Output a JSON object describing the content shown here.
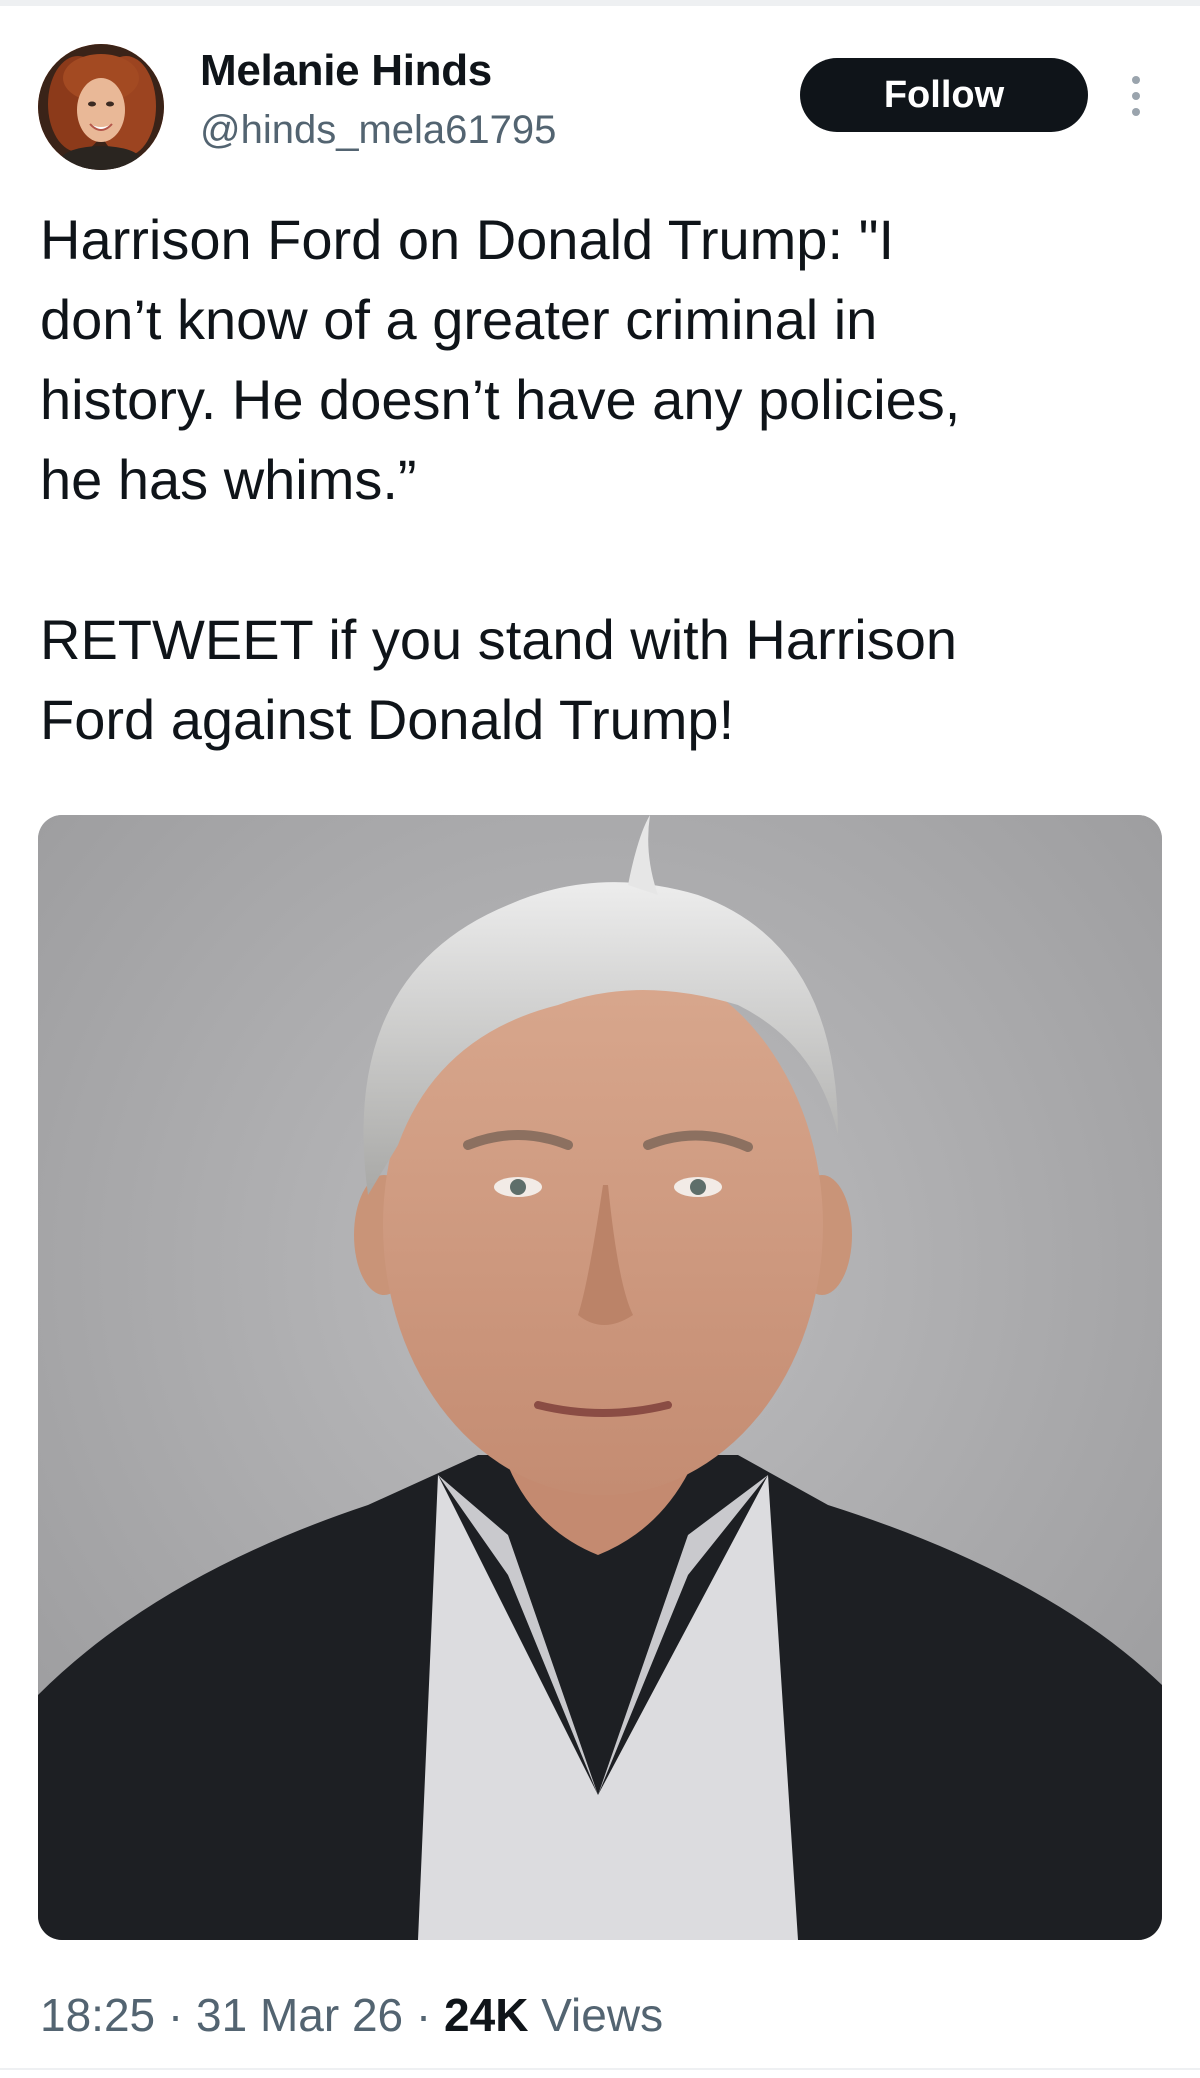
{
  "author": {
    "name": "Melanie Hinds",
    "handle": "@hinds_mela61795"
  },
  "actions": {
    "follow_label": "Follow",
    "more_icon": "more-dots-vertical-icon"
  },
  "tweet": {
    "paragraph_1": "Harrison Ford on Donald Trump: \"I\ndon’t know of a greater criminal in\nhistory. He doesn’t have any policies,\nhe has whims.”",
    "paragraph_2": "RETWEET if you stand with Harrison\nFord against Donald Trump!"
  },
  "meta": {
    "time": "18:25",
    "separator": " · ",
    "date": "31 Mar 26",
    "views_count": "24K",
    "views_label": "Views"
  },
  "colors": {
    "text": "#0f1419",
    "secondary_text": "#536471",
    "follow_bg": "#0f1419",
    "follow_text": "#ffffff"
  }
}
